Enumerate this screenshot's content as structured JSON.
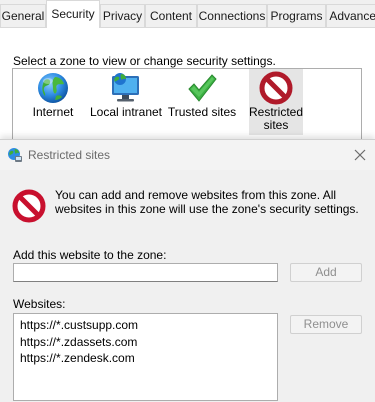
{
  "tabs": [
    "General",
    "Security",
    "Privacy",
    "Content",
    "Connections",
    "Programs",
    "Advanced"
  ],
  "active_tab": "Security",
  "zone_prompt": "Select a zone to view or change security settings.",
  "zones": [
    {
      "label": "Internet",
      "icon": "globe-icon"
    },
    {
      "label": "Local intranet",
      "icon": "monitor-globe-icon"
    },
    {
      "label": "Trusted sites",
      "icon": "checkmark-icon"
    },
    {
      "label": "Restricted sites",
      "icon": "restricted-icon",
      "selected": true
    }
  ],
  "dialog": {
    "title": "Restricted sites",
    "info_text": "You can add and remove websites from this zone. All websites in this zone will use the zone's security settings.",
    "add_label": "Add this website to the zone:",
    "add_value": "",
    "add_button": "Add",
    "websites_label": "Websites:",
    "websites": [
      "https://*.custsupp.com",
      "https://*.zdassets.com",
      "https://*.zendesk.com"
    ],
    "remove_button": "Remove"
  },
  "colors": {
    "restricted_red": "#c8102e",
    "check_green": "#3cb043",
    "accent_blue": "#1e73c9"
  }
}
